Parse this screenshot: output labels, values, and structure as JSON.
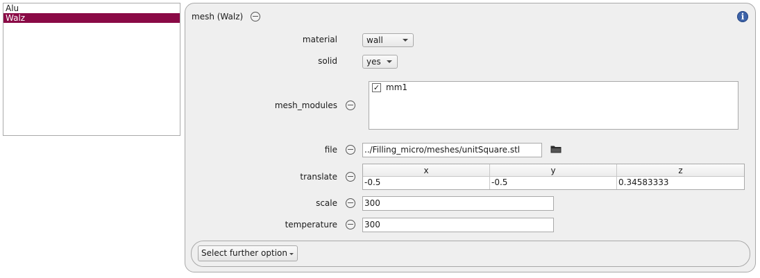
{
  "list": {
    "items": [
      {
        "label": "Alu",
        "selected": false
      },
      {
        "label": "Walz",
        "selected": true
      }
    ],
    "selected_color": "#8a0a46"
  },
  "panel": {
    "title": "mesh (Walz)",
    "info_icon": "info-icon",
    "fields": {
      "material": {
        "label": "material",
        "value": "wall"
      },
      "solid": {
        "label": "solid",
        "value": "yes"
      },
      "mesh_modules": {
        "label": "mesh_modules",
        "items": [
          {
            "label": "mm1",
            "checked": true,
            "mark": "✓"
          }
        ]
      },
      "file": {
        "label": "file",
        "value": "../Filling_micro/meshes/unitSquare.stl",
        "icon": "folder-icon"
      },
      "translate": {
        "label": "translate",
        "columns": [
          "x",
          "y",
          "z"
        ],
        "values": [
          "-0.5",
          "-0.5",
          "0.34583333"
        ]
      },
      "scale": {
        "label": "scale",
        "value": "300"
      },
      "temperature": {
        "label": "temperature",
        "value": "300"
      }
    },
    "further_option": {
      "label": "Select further option"
    }
  }
}
